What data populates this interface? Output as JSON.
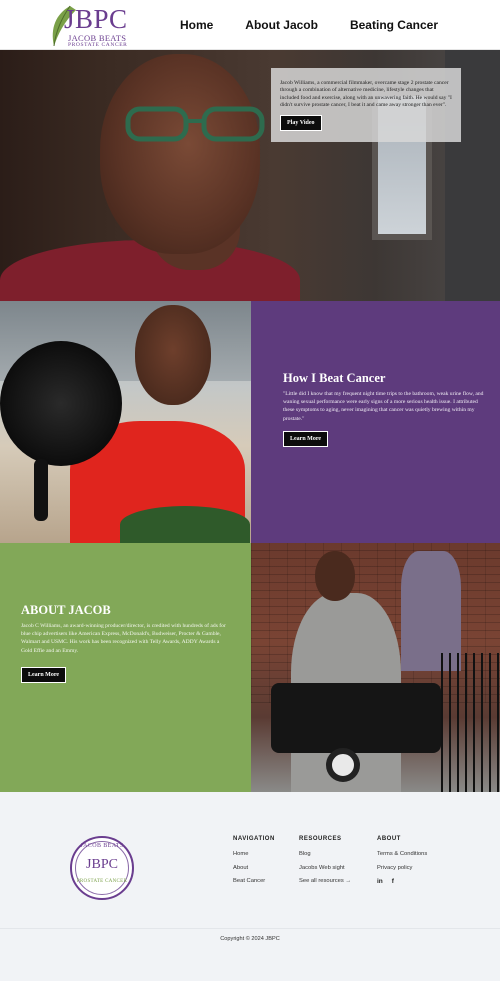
{
  "header": {
    "logo": {
      "main": "JBPC",
      "line1": "JACOB BEATS",
      "line2": "PROSTATE CANCER"
    },
    "nav": [
      {
        "label": "Home"
      },
      {
        "label": "About Jacob"
      },
      {
        "label": "Beating Cancer"
      }
    ]
  },
  "hero": {
    "text": "Jacob Williams, a commercial filmmaker, overcame stage 2 prostate cancer through a combination of alternative medicine, lifestyle changes that included food and exercise, along with an unwavering faith. He would say \"I didn't survive prostate cancer, I beat it and came away stronger than ever\".",
    "button": "Play Video"
  },
  "beat": {
    "title": "How I Beat Cancer",
    "text": "\"Little did I know that my frequent night time trips to the bathroom, weak urine flow, and waning sexual performance were early signs of a more serious health issue. I attributed these symptoms to aging, never imagining that cancer was quietly brewing within my prostate.\"",
    "button": "Learn More"
  },
  "about": {
    "title": "ABOUT JACOB",
    "text": "Jacob C Williams, an award-winning producer/director, is credited with hundreds of ads for blue chip advertisers like American Express, McDonald's, Budweiser, Procter & Gamble, Walmart and USMC. His work has been recognized with Telly Awards, ADDY Awards a Gold Effie and an Emmy.",
    "button": "Learn More"
  },
  "footer": {
    "logo": {
      "top": "JACOB BEATS",
      "main": "JBPC",
      "bottom": "PROSTATE CANCER"
    },
    "navigation": {
      "heading": "NAVIGATION",
      "links": [
        "Home",
        "About",
        "Beat Cancer"
      ]
    },
    "resources": {
      "heading": "RESOURCES",
      "links": [
        "Blog",
        "Jacobs Web sight",
        "See all resources →"
      ]
    },
    "about": {
      "heading": "ABOUT",
      "links": [
        "Terms & Conditions",
        "Privacy policy"
      ],
      "social": [
        "in",
        "f"
      ]
    },
    "copyright": "Copyright © 2024 JBPC"
  },
  "colors": {
    "brand_purple": "#6a3d8f",
    "section_purple": "#5e3b7d",
    "section_green": "#82a858",
    "footer_bg": "#f1f3f6"
  }
}
